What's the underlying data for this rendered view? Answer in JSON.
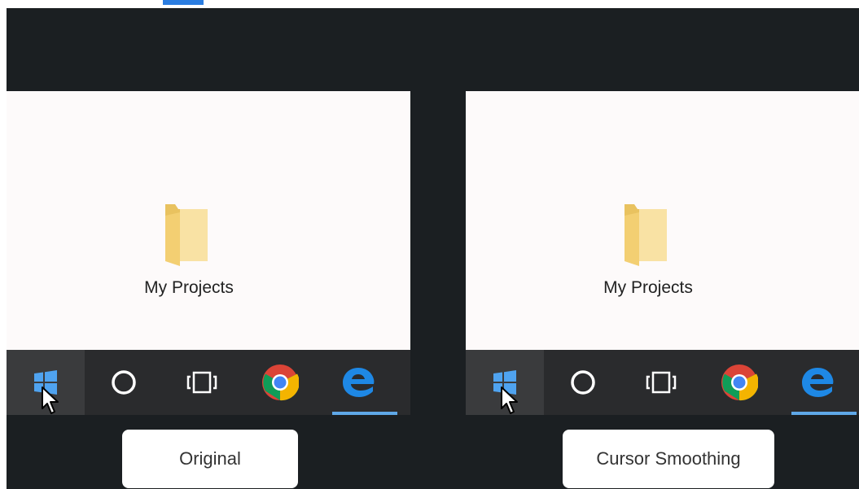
{
  "panels": [
    {
      "folder_label": "My Projects",
      "caption": "Original"
    },
    {
      "folder_label": "My Projects",
      "caption": "Cursor Smoothing"
    }
  ],
  "taskbar_icons": [
    "windows-start-icon",
    "cortana-circle-icon",
    "task-view-icon",
    "chrome-icon",
    "edge-icon"
  ],
  "colors": {
    "stage_background": "#1b1f22",
    "desktop_background": "#fdfafa",
    "taskbar": "#2a2b2d",
    "start_highlight": "#3a3b3d",
    "accent_blue": "#2a7de1",
    "active_underline": "#5fa8e8",
    "folder_yellow": "#f6d889"
  }
}
